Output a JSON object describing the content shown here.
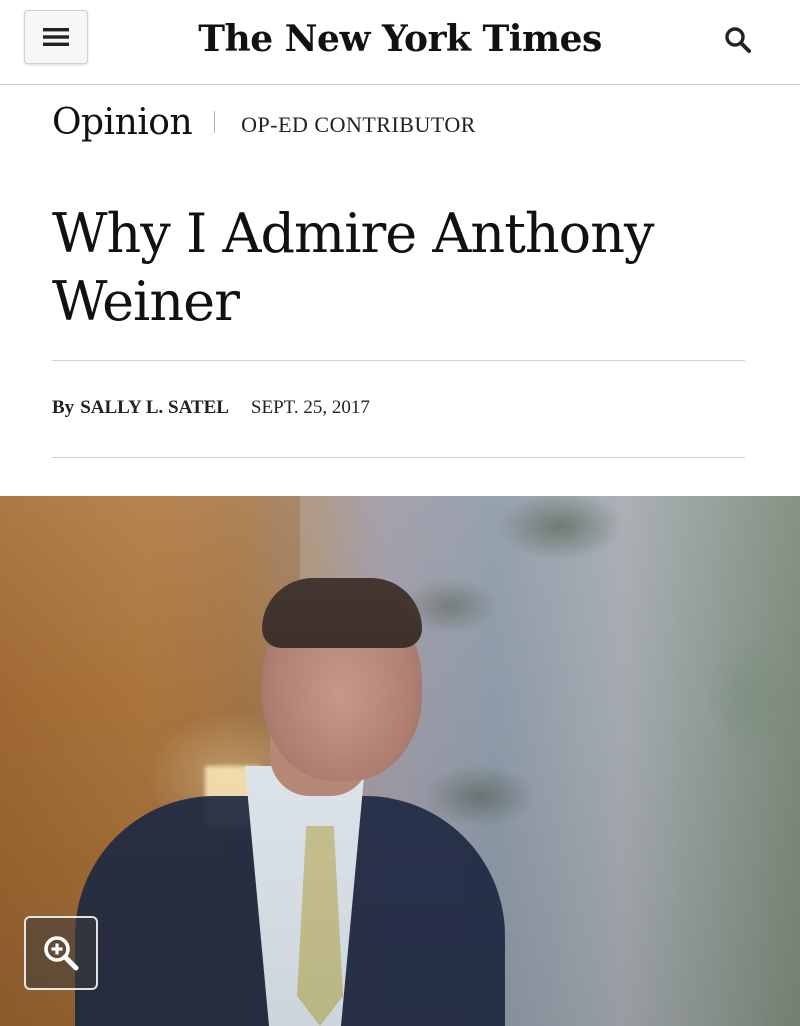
{
  "header": {
    "masthead": "The New York Times",
    "menu_icon": "hamburger-menu-icon",
    "search_icon": "search-icon"
  },
  "section": {
    "name": "Opinion",
    "subsection": "OP-ED CONTRIBUTOR"
  },
  "article": {
    "headline": "Why I Admire Anthony Weiner",
    "byline_prefix": "By",
    "author": "SALLY L. SATEL",
    "date": "SEPT. 25, 2017"
  },
  "lead_image": {
    "enlarge_icon": "zoom-in-icon"
  },
  "colors": {
    "text": "#121212",
    "rule": "#d2d2d2",
    "background": "#ffffff"
  }
}
